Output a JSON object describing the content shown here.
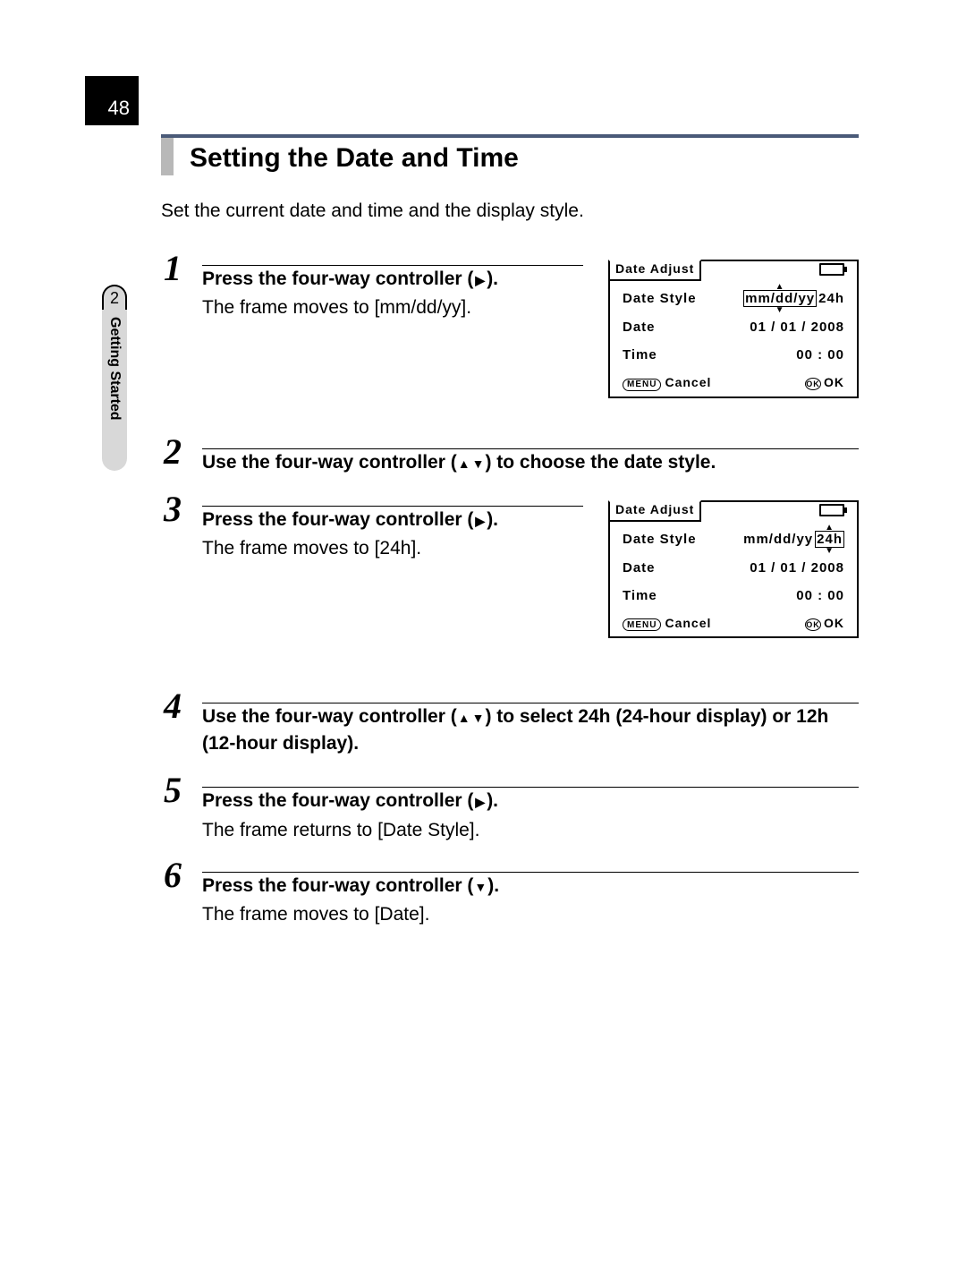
{
  "page_number": "48",
  "side_tab": {
    "number": "2",
    "label": "Getting Started"
  },
  "heading": "Setting the Date and Time",
  "intro": "Set the current date and time and the display style.",
  "steps": {
    "s1": {
      "num": "1",
      "title_a": "Press the four-way controller (",
      "title_b": ").",
      "desc": "The frame moves to [mm/dd/yy]."
    },
    "s2": {
      "num": "2",
      "title_a": "Use the four-way controller (",
      "title_b": ") to choose the date style."
    },
    "s3": {
      "num": "3",
      "title_a": "Press the four-way controller (",
      "title_b": ").",
      "desc": "The frame moves to [24h]."
    },
    "s4": {
      "num": "4",
      "title_a": "Use the four-way controller (",
      "title_b": ") to select 24h (24-hour display) or 12h (12-hour display)."
    },
    "s5": {
      "num": "5",
      "title_a": "Press the four-way controller (",
      "title_b": ").",
      "desc": "The frame returns to [Date Style]."
    },
    "s6": {
      "num": "6",
      "title_a": "Press the four-way controller (",
      "title_b": ").",
      "desc": "The frame moves to [Date]."
    }
  },
  "lcd": {
    "tab": "Date Adjust",
    "row1_label": "Date Style",
    "row1_val_a": "mm/dd/yy",
    "row1_val_b": "24h",
    "row2_label": "Date",
    "row2_val": "01 / 01 / 2008",
    "row3_label": "Time",
    "row3_val": "00 : 00",
    "menu_label": "MENU",
    "cancel": "Cancel",
    "ok_small": "OK",
    "ok": "OK"
  }
}
